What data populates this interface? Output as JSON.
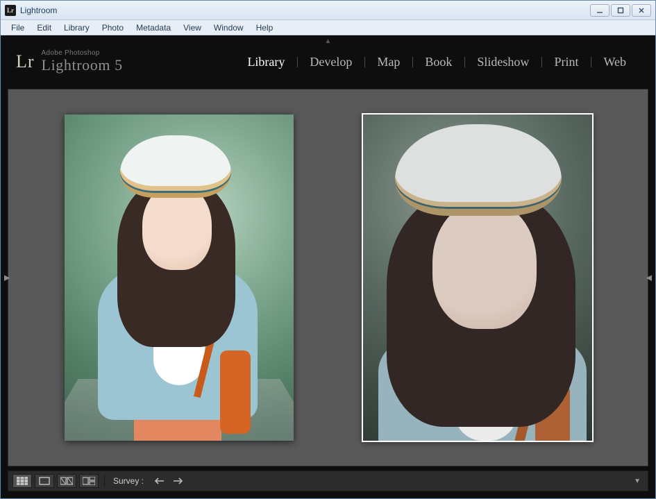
{
  "window": {
    "icon_text": "Lr",
    "title": "Lightroom"
  },
  "menu": {
    "items": [
      "File",
      "Edit",
      "Library",
      "Photo",
      "Metadata",
      "View",
      "Window",
      "Help"
    ]
  },
  "branding": {
    "badge": "Lr",
    "subtitle": "Adobe Photoshop",
    "product": "Lightroom 5"
  },
  "modules": {
    "items": [
      "Library",
      "Develop",
      "Map",
      "Book",
      "Slideshow",
      "Print",
      "Web"
    ],
    "active_index": 0
  },
  "viewer": {
    "selected_photo_index": 1
  },
  "toolbar": {
    "mode_label": "Survey :"
  }
}
